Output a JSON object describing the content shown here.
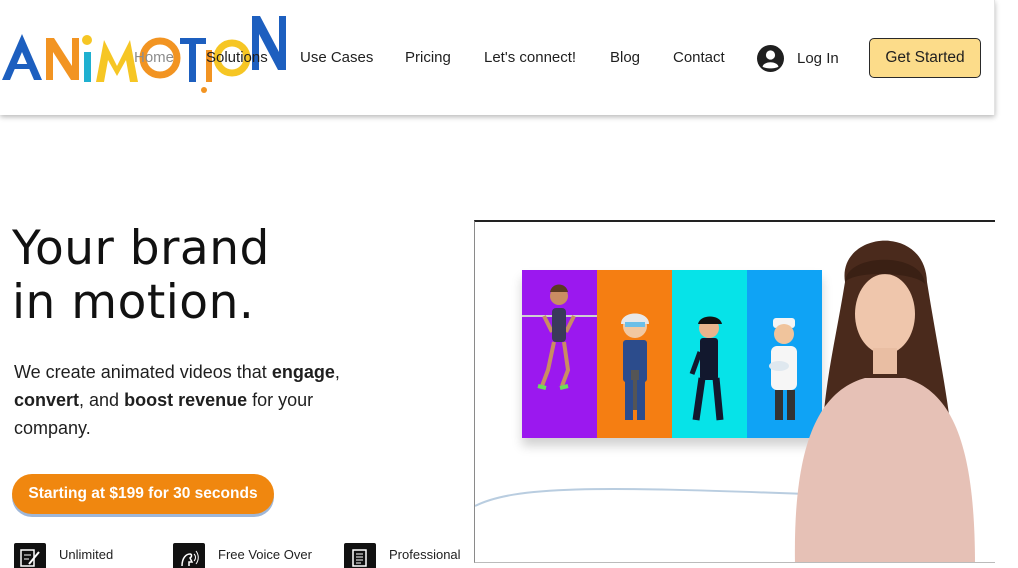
{
  "brand": {
    "logo_text": "ANIMOTION"
  },
  "nav": {
    "items": [
      {
        "label": "Home",
        "active": true
      },
      {
        "label": "Solutions"
      },
      {
        "label": "Use Cases"
      },
      {
        "label": "Pricing"
      },
      {
        "label": "Let's connect!"
      },
      {
        "label": "Blog"
      },
      {
        "label": "Contact"
      }
    ],
    "login_label": "Log In",
    "get_started_label": "Get Started"
  },
  "hero": {
    "title_line1": "Your brand",
    "title_line2": "in motion.",
    "desc": {
      "t1": "We create animated videos that ",
      "b1": "engage",
      "t2": ", ",
      "b2": "convert",
      "t3": ", and ",
      "b3": "boost revenue",
      "t4": " for your company."
    },
    "cta_label": "Starting at $199 for 30 seconds"
  },
  "features": [
    {
      "label": "Unlimited Revisions",
      "icon": "edit-document-icon"
    },
    {
      "label": "Free Voice Over Talent",
      "icon": "voice-icon"
    },
    {
      "label": "Professional Scripts",
      "icon": "script-icon"
    }
  ],
  "colors": {
    "accent_orange": "#f0870f",
    "button_yellow": "#fcdc8a",
    "logo_blue": "#1d5fbf",
    "logo_orange": "#f29422",
    "logo_yellow": "#f6c624",
    "logo_teal": "#1fb0d0"
  }
}
